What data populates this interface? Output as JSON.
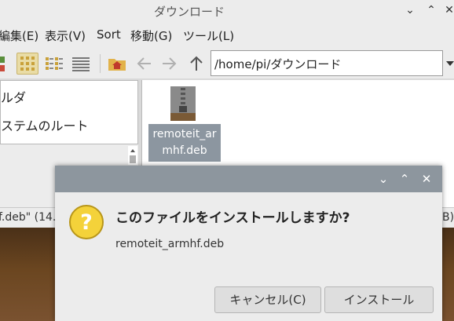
{
  "window": {
    "title": "ダウンロード"
  },
  "menubar": {
    "items": [
      "編集(E)",
      "表示(V)",
      "Sort",
      "移動(G)",
      "ツール(L)"
    ]
  },
  "toolbar": {
    "path": "/home/pi/ダウンロード"
  },
  "sidebar": {
    "items": [
      "ルダ",
      "ステムのルート"
    ]
  },
  "files": [
    {
      "name_line1": "remoteit_ar",
      "name_line2": "mhf.deb",
      "icon": "archive-icon"
    }
  ],
  "statusbar": {
    "left": "f.deb\" (14.4",
    "right": "B)"
  },
  "dialog": {
    "question": "このファイルをインストールしますか?",
    "filename": "remoteit_armhf.deb",
    "cancel_label": "キャンセル(C)",
    "install_label": "インストール"
  },
  "colors": {
    "accent_selection": "#8c96a0",
    "dialog_header": "#8d969e",
    "question_icon": "#f4d23a"
  }
}
